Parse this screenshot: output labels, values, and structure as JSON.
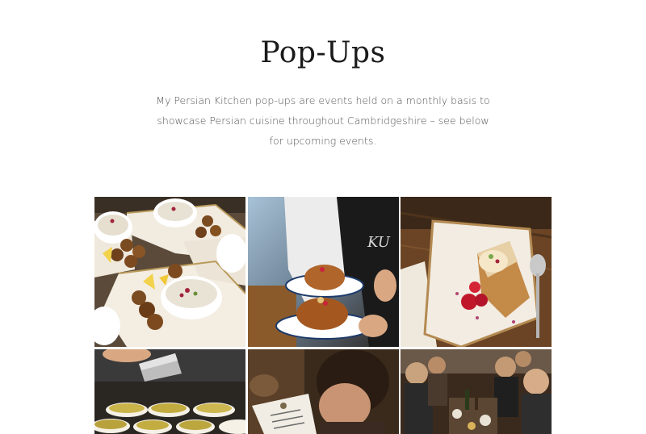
{
  "page": {
    "title": "Pop-Ups",
    "intro": "My Persian Kitchen pop-ups are events held on a monthly basis to showcase Persian cuisine throughout Cambridgeshire – see below for upcoming events."
  },
  "gallery": {
    "photos": [
      {
        "subject": "falafel-platters-photo"
      },
      {
        "subject": "chef-serving-dish-photo"
      },
      {
        "subject": "rolled-dessert-photo"
      },
      {
        "subject": "spice-shaker-bowls-photo"
      },
      {
        "subject": "diner-reading-menu-photo"
      },
      {
        "subject": "crowded-dining-table-photo"
      }
    ]
  },
  "colors": {
    "background": "#ffffff",
    "title": "#1a1a1a",
    "text": "#555555"
  }
}
